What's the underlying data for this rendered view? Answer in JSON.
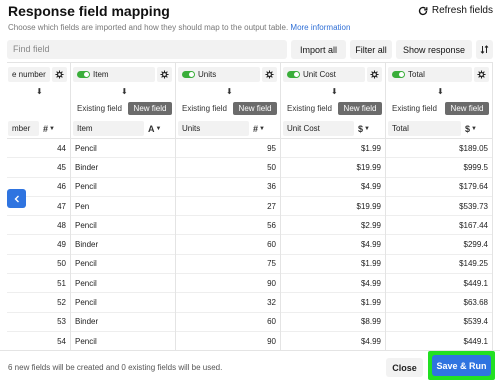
{
  "header": {
    "title": "Response field mapping",
    "subtitle": "Choose which fields are imported and how they should map to the output table.",
    "more_link": "More information",
    "refresh_label": "Refresh fields"
  },
  "toolbar": {
    "find_placeholder": "Find field",
    "import_all": "Import all",
    "filter_all": "Filter all",
    "show_response": "Show response"
  },
  "columns": [
    {
      "field": "e number",
      "existing": "",
      "new_field": "",
      "mapped": "mber",
      "type": "#",
      "values": [
        "44",
        "45",
        "46",
        "47",
        "48",
        "49",
        "50",
        "51",
        "52",
        "53",
        "54"
      ]
    },
    {
      "field": "Item",
      "existing": "Existing field",
      "new_field": "New field",
      "mapped": "Item",
      "type": "A",
      "values": [
        "Pencil",
        "Binder",
        "Pencil",
        "Pen",
        "Pencil",
        "Binder",
        "Pencil",
        "Pencil",
        "Pencil",
        "Binder",
        "Pencil"
      ]
    },
    {
      "field": "Units",
      "existing": "Existing field",
      "new_field": "New field",
      "mapped": "Units",
      "type": "#",
      "values": [
        "95",
        "50",
        "36",
        "27",
        "56",
        "60",
        "75",
        "90",
        "32",
        "60",
        "90"
      ]
    },
    {
      "field": "Unit Cost",
      "existing": "Existing field",
      "new_field": "New field",
      "mapped": "Unit Cost",
      "type": "$",
      "values": [
        "$1.99",
        "$19.99",
        "$4.99",
        "$19.99",
        "$2.99",
        "$4.99",
        "$1.99",
        "$4.99",
        "$1.99",
        "$8.99",
        "$4.99"
      ]
    },
    {
      "field": "Total",
      "existing": "Existing field",
      "new_field": "New field",
      "mapped": "Total",
      "type": "$",
      "values": [
        "$189.05",
        "$999.5",
        "$179.64",
        "$539.73",
        "$167.44",
        "$299.4",
        "$149.25",
        "$449.1",
        "$63.68",
        "$539.4",
        "$449.1"
      ]
    }
  ],
  "footer": {
    "info": "6 new fields will be created and 0 existing fields will be used.",
    "close": "Close",
    "save_run": "Save & Run"
  },
  "colors": {
    "accent": "#2f74e0",
    "toggle_on": "#3aae3a",
    "highlight": "#22e022"
  }
}
